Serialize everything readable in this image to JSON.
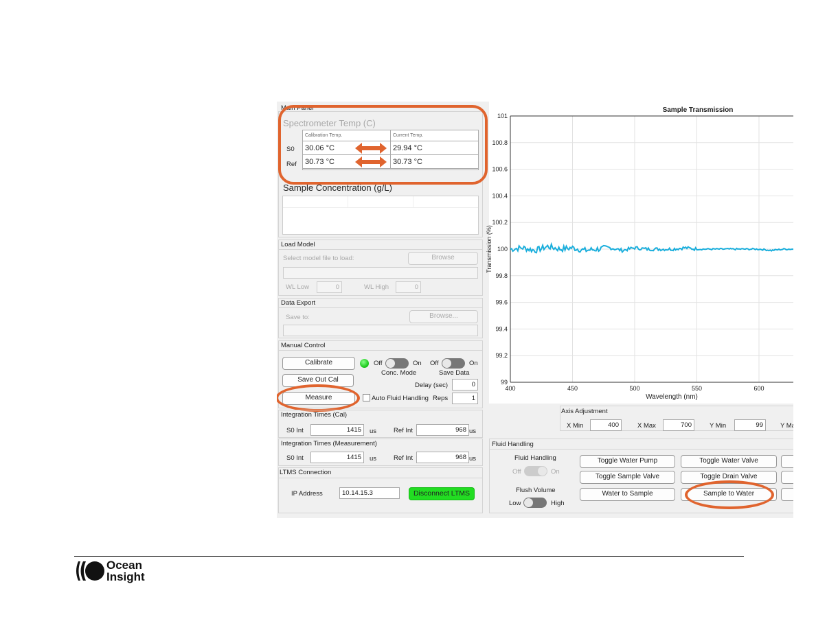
{
  "main_panel": {
    "title": "Main Panel",
    "spectrometer_temp": {
      "heading": "Spectrometer Temp (C)",
      "col_headers": [
        "Calibration Temp.",
        "Current Temp."
      ],
      "rows": [
        {
          "label": "S0",
          "calibration": "30.06 °C",
          "current": "29.94 °C"
        },
        {
          "label": "Ref",
          "calibration": "30.73 °C",
          "current": "30.73 °C"
        }
      ]
    },
    "sample_concentration": {
      "heading": "Sample Concentration (g/L)"
    }
  },
  "load_model": {
    "title": "Load Model",
    "prompt": "Select model file to load:",
    "browse": "Browse",
    "wl_low_label": "WL Low",
    "wl_low": "0",
    "wl_high_label": "WL High",
    "wl_high": "0"
  },
  "data_export": {
    "title": "Data Export",
    "prompt": "Save to:",
    "browse": "Browse..."
  },
  "manual_control": {
    "title": "Manual Control",
    "calibrate": "Calibrate",
    "save_out_cal": "Save Out Cal",
    "measure": "Measure",
    "conc_mode": {
      "off": "Off",
      "on": "On",
      "label": "Conc. Mode"
    },
    "save_data": {
      "off": "Off",
      "on": "On",
      "label": "Save Data"
    },
    "delay_label": "Delay (sec)",
    "delay": "0",
    "auto_fluid": "Auto Fluid Handling",
    "reps_label": "Reps",
    "reps": "1",
    "status_color": "#22cc22"
  },
  "int_cal": {
    "title": "Integration Times (Cal)",
    "s0_label": "S0 Int",
    "s0": "1415",
    "ref_label": "Ref Int",
    "ref": "968",
    "unit": "us"
  },
  "int_meas": {
    "title": "Integration Times (Measurement)",
    "s0_label": "S0 Int",
    "s0": "1415",
    "ref_label": "Ref Int",
    "ref": "968",
    "unit": "us"
  },
  "ltms": {
    "title": "LTMS Connection",
    "ip_label": "IP Address",
    "ip": "10.14.15.3",
    "disconnect": "Disconnect LTMS",
    "button_color": "#22dd22"
  },
  "axis_adjustment": {
    "title": "Axis Adjustment",
    "xmin_label": "X Min",
    "xmin": "400",
    "xmax_label": "X Max",
    "xmax": "700",
    "ymin_label": "Y Min",
    "ymin": "99",
    "ymax_label": "Y Ma"
  },
  "fluid_handling": {
    "title": "Fluid Handling",
    "fh_label": "Fluid Handling",
    "fh_off": "Off",
    "fh_on": "On",
    "flush_label": "Flush Volume",
    "flush_low": "Low",
    "flush_high": "High",
    "buttons": [
      "Toggle Water Pump",
      "Toggle Water Valve",
      "Toggle Sample Valve",
      "Toggle Drain Valve",
      "Water to Sample",
      "Sample to Water"
    ]
  },
  "chart_data": {
    "type": "line",
    "title": "Sample Transmission",
    "xlabel": "Wavelength (nm)",
    "ylabel": "Transmission (%)",
    "xlim": [
      400,
      700
    ],
    "ylim": [
      99,
      101
    ],
    "grid": true,
    "line_color": "#1aaedc",
    "xticks": [
      "400",
      "450",
      "500",
      "550",
      "600"
    ],
    "yticks": [
      "99",
      "99.2",
      "99.4",
      "99.6",
      "99.8",
      "100",
      "100.2",
      "100.4",
      "100.6",
      "100.8",
      "101"
    ],
    "x": [
      400,
      410,
      420,
      430,
      440,
      450,
      460,
      470,
      480,
      490,
      500,
      510,
      520,
      530,
      540,
      550,
      560,
      570,
      580,
      590,
      600,
      610,
      620,
      630,
      640,
      650
    ],
    "values": [
      100.0,
      100.01,
      99.99,
      100.02,
      100.0,
      100.01,
      99.99,
      100.0,
      100.01,
      99.99,
      100.01,
      100.0,
      100.0,
      100.0,
      100.01,
      100.0,
      100.0,
      100.0,
      100.0,
      100.0,
      100.0,
      99.99,
      100.0,
      100.0,
      100.0,
      100.01
    ]
  },
  "footer": {
    "brand_line1": "Ocean",
    "brand_line2": "Insight"
  },
  "annotation_color": "#e0642e"
}
